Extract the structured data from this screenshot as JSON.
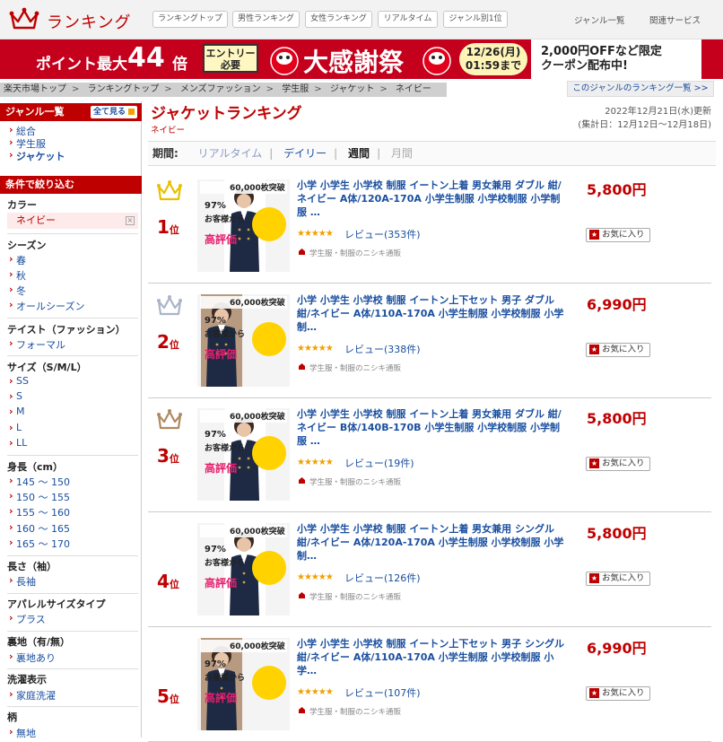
{
  "header": {
    "logo_text": "ランキング",
    "nav_buttons": [
      "ランキングトップ",
      "男性ランキング",
      "女性ランキング",
      "リアルタイム",
      "ジャンル別1位"
    ],
    "links": [
      "ジャンル一覧",
      "関連サービス"
    ]
  },
  "banner": {
    "point_text": "ポイント最大",
    "point_num": "44",
    "point_unit": "倍",
    "entry_line1": "エントリー",
    "entry_line2": "必要",
    "sale_title": "大感謝祭",
    "date_line1": "12/26(月)",
    "date_line2": "01:59まで",
    "coupon_line1": "2,000円OFFなど限定",
    "coupon_line2": "クーポン配布中!"
  },
  "breadcrumb": [
    "楽天市場トップ",
    "ランキングトップ",
    "メンズファッション",
    "学生服",
    "ジャケット",
    "ネイビー"
  ],
  "genre_ranking_link": "このジャンルのランキング一覧 >>",
  "sidebar": {
    "genre_title": "ジャンル一覧",
    "see_all": "全て見る",
    "genres": [
      "総合",
      "学生服",
      "ジャケット"
    ],
    "filter_title": "条件で絞り込む",
    "color_label": "カラー",
    "color_selected": "ネイビー",
    "season_label": "シーズン",
    "seasons": [
      "春",
      "秋",
      "冬",
      "オールシーズン"
    ],
    "taste_label": "テイスト（ファッション）",
    "tastes": [
      "フォーマル"
    ],
    "size_label": "サイズ（S/M/L）",
    "sizes": [
      "SS",
      "S",
      "M",
      "L",
      "LL"
    ],
    "height_label": "身長（cm）",
    "heights": [
      "145 ～ 150",
      "150 ～ 155",
      "155 ～ 160",
      "160 ～ 165",
      "165 ～ 170"
    ],
    "sleeve_label": "長さ（袖）",
    "sleeves": [
      "長袖"
    ],
    "apparel_label": "アパレルサイズタイプ",
    "apparels": [
      "プラス"
    ],
    "lining_label": "裏地（有/無）",
    "linings": [
      "裏地あり"
    ],
    "wash_label": "洗濯表示",
    "washes": [
      "家庭洗濯"
    ],
    "pattern_label": "柄",
    "patterns": [
      "無地"
    ]
  },
  "main": {
    "title": "ジャケットランキング",
    "subtitle": "ネイビー",
    "updated": "2022年12月21日(水)更新",
    "period_range": "(集計日：12月12日～12月18日)",
    "period_label": "期間:",
    "periods": [
      "リアルタイム",
      "デイリー",
      "週間",
      "月間"
    ],
    "active_period": "週間"
  },
  "items": [
    {
      "rank": "1",
      "rank_suffix": "位",
      "name": "小学 小学生 小学校 制服 イートン上着 男女兼用 ダブル 紺/ネイビー A体/120A-170A 小学生制服 小学校制服 小学制服 …",
      "stars": "★★★★★",
      "rating": 4.5,
      "review": "レビュー(353件)",
      "shop": "学生服・制服のニシキ通販",
      "price": "5,800円",
      "fav": "お気に入り",
      "thumb_badge": "60,000枚突破",
      "thumb_pct": "97%",
      "thumb_text": "お客様から",
      "thumb_eval": "高評価",
      "crown_color": "#e8c000"
    },
    {
      "rank": "2",
      "rank_suffix": "位",
      "name": "小学 小学生 小学校 制服 イートン上下セット 男子 ダブル 紺/ネイビー A体/110A-170A 小学生制服 小学校制服 小学制…",
      "stars": "★★★★★",
      "rating": 4.5,
      "review": "レビュー(338件)",
      "shop": "学生服・制服のニシキ通販",
      "price": "6,990円",
      "fav": "お気に入り",
      "thumb_badge": "60,000枚突破",
      "thumb_pct": "97%",
      "thumb_text": "お客様から",
      "thumb_eval": "高評価",
      "crown_color": "#aab4c8"
    },
    {
      "rank": "3",
      "rank_suffix": "位",
      "name": "小学 小学生 小学校 制服 イートン上着 男女兼用 ダブル 紺/ネイビー B体/140B-170B 小学生制服 小学校制服 小学制服 …",
      "stars": "★★★★★",
      "rating": 4.5,
      "review": "レビュー(19件)",
      "shop": "学生服・制服のニシキ通販",
      "price": "5,800円",
      "fav": "お気に入り",
      "thumb_badge": "60,000枚突破",
      "thumb_pct": "97%",
      "thumb_text": "お客様から",
      "thumb_eval": "高評価",
      "crown_color": "#b08a60"
    },
    {
      "rank": "4",
      "rank_suffix": "位",
      "name": "小学 小学生 小学校 制服 イートン上着 男女兼用 シングル 紺/ネイビー A体/120A-170A 小学生制服 小学校制服 小学制…",
      "stars": "★★★★★",
      "rating": 4.5,
      "review": "レビュー(126件)",
      "shop": "学生服・制服のニシキ通販",
      "price": "5,800円",
      "fav": "お気に入り",
      "thumb_badge": "60,000枚突破",
      "thumb_pct": "97%",
      "thumb_text": "お客様から",
      "thumb_eval": "高評価",
      "crown_color": ""
    },
    {
      "rank": "5",
      "rank_suffix": "位",
      "name": "小学 小学生 小学校 制服 イートン上下セット 男子 シングル 紺/ネイビー A体/110A-170A 小学生制服 小学校制服 小学…",
      "stars": "★★★★★",
      "rating": 4.5,
      "review": "レビュー(107件)",
      "shop": "学生服・制服のニシキ通販",
      "price": "6,990円",
      "fav": "お気に入り",
      "thumb_badge": "60,000枚突破",
      "thumb_pct": "97%",
      "thumb_text": "お客様から",
      "thumb_eval": "高評価",
      "crown_color": ""
    }
  ]
}
